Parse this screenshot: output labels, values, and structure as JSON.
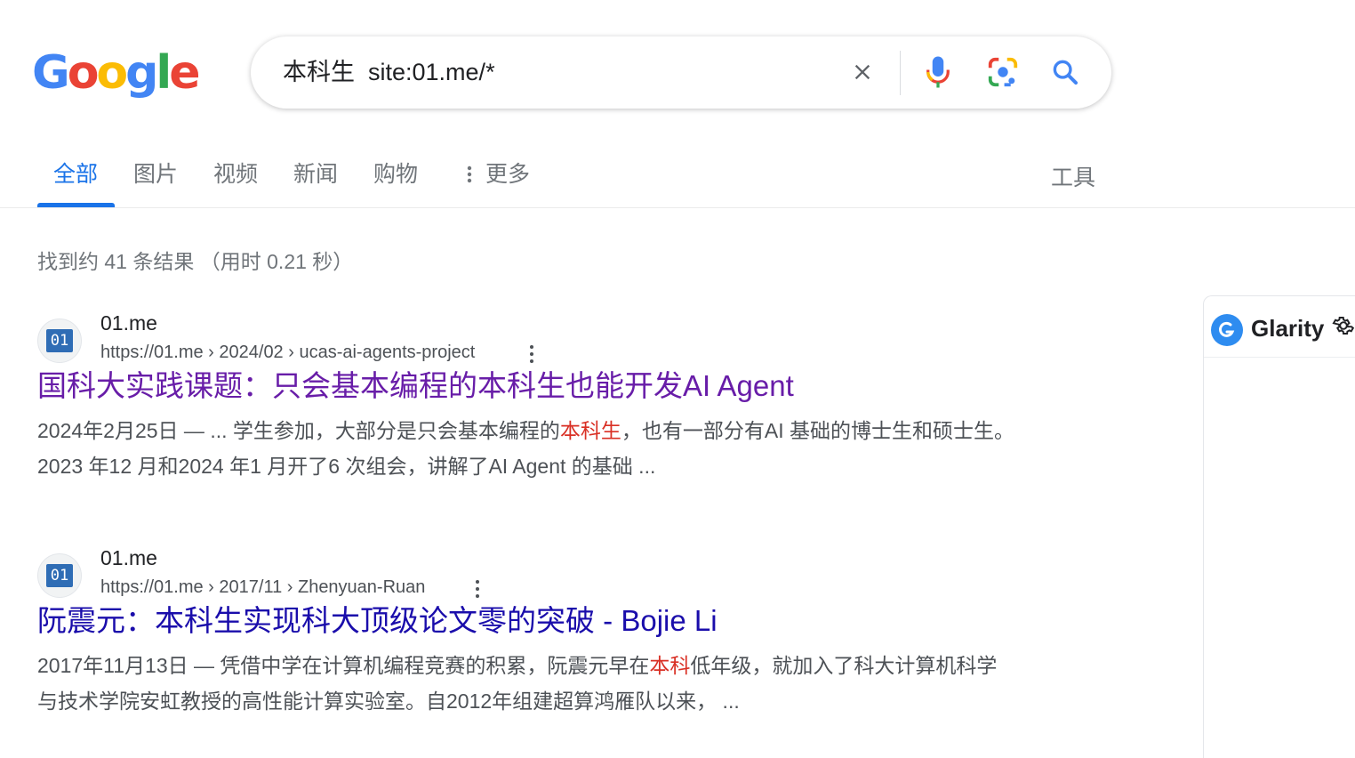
{
  "logo": {
    "text": "Google",
    "letters": [
      "G",
      "o",
      "o",
      "g",
      "l",
      "e"
    ],
    "colors": [
      "#4285F4",
      "#EA4335",
      "#FBBC05",
      "#4285F4",
      "#34A853",
      "#EA4335"
    ]
  },
  "search": {
    "query": "本科生  site:01.me/*"
  },
  "tabs": [
    {
      "label": "全部",
      "active": true
    },
    {
      "label": "图片"
    },
    {
      "label": "视频"
    },
    {
      "label": "新闻"
    },
    {
      "label": "购物"
    },
    {
      "label": "更多"
    }
  ],
  "tools_label": "工具",
  "stats": "找到约 41 条结果 （用时 0.21 秒）",
  "results": [
    {
      "favicon_text": "01",
      "site_name": "01.me",
      "url": "https://01.me › 2024/02 › ucas-ai-agents-project",
      "title": "国科大实践课题：只会基本编程的本科生也能开发AI Agent",
      "snippet": {
        "before": "2024年2月25日 — ... 学生参加，大部分是只会基本编程的",
        "highlight": "本科生",
        "after": "，也有一部分有AI 基础的博士生和硕士生。 2023 年12 月和2024 年1 月开了6 次组会，讲解了AI Agent 的基础 ..."
      }
    },
    {
      "favicon_text": "01",
      "site_name": "01.me",
      "url": "https://01.me › 2017/11 › Zhenyuan-Ruan",
      "title": "阮震元：本科生实现科大顶级论文零的突破 - Bojie Li",
      "snippet": {
        "before": "2017年11月13日 — 凭借中学在计算机编程竞赛的积累，阮震元早在",
        "highlight": "本科",
        "after": "低年级，就加入了科大计算机科学与技术学院安虹教授的高性能计算实验室。自2012年组建超算鸿雁队以来，  ..."
      }
    }
  ],
  "sidebar": {
    "name": "Glarity"
  }
}
